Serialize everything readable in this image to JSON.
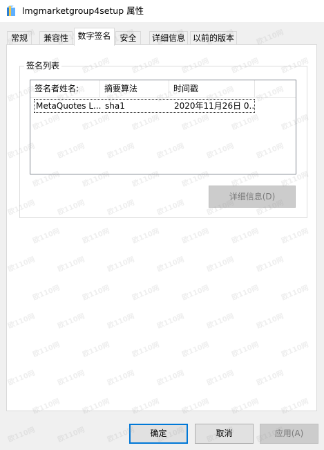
{
  "window": {
    "title": "lmgmarketgroup4setup 属性",
    "icon": "installer-box-icon"
  },
  "tabs": [
    {
      "label": "常规",
      "active": false
    },
    {
      "label": "兼容性",
      "active": false
    },
    {
      "label": "数字签名",
      "active": true
    },
    {
      "label": "安全",
      "active": false
    },
    {
      "label": "详细信息",
      "active": false
    },
    {
      "label": "以前的版本",
      "active": false
    }
  ],
  "signature_group": {
    "label": "签名列表",
    "columns": [
      "签名者姓名:",
      "摘要算法",
      "时间戳"
    ],
    "rows": [
      {
        "signer": "MetaQuotes L...",
        "digest": "sha1",
        "timestamp": "2020年11月26日 0..."
      }
    ],
    "details_button": "详细信息(D)"
  },
  "buttons": {
    "ok": "确定",
    "cancel": "取消",
    "apply": "应用(A)"
  },
  "watermark": "欧110网",
  "colors": {
    "accent": "#0078d7",
    "window_bg": "#f0f0f0",
    "panel_bg": "#ffffff"
  }
}
